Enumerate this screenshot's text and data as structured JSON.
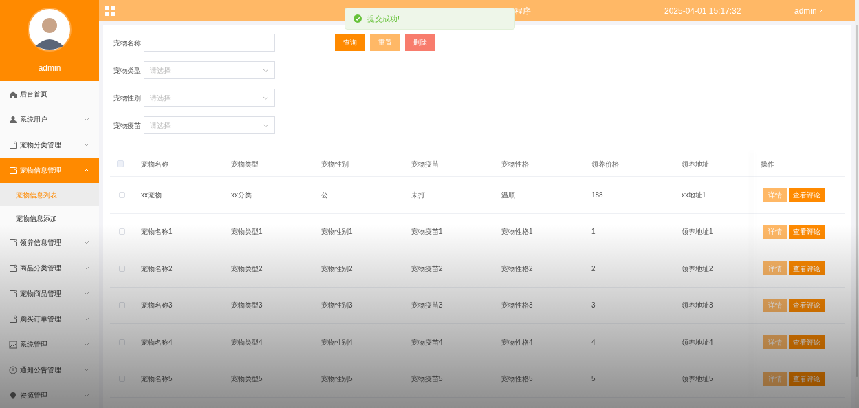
{
  "header": {
    "title": "程序",
    "datetime": "2025-04-01 15:17:32",
    "user": "admin"
  },
  "toast": {
    "message": "提交成功!"
  },
  "sidebar": {
    "username": "admin",
    "items": [
      {
        "label": "后台首页",
        "kind": "home",
        "selected": false
      },
      {
        "label": "系统用户",
        "kind": "user",
        "expanded": false,
        "selected": false
      },
      {
        "label": "宠物分类管理",
        "kind": "doc",
        "expanded": false,
        "selected": false
      },
      {
        "label": "宠物信息管理",
        "kind": "doc",
        "expanded": true,
        "selected": true,
        "children": [
          {
            "label": "宠物信息列表",
            "selected": true
          },
          {
            "label": "宠物信息添加",
            "selected": false
          }
        ]
      },
      {
        "label": "领养信息管理",
        "kind": "doc",
        "expanded": false,
        "selected": false
      },
      {
        "label": "商品分类管理",
        "kind": "doc",
        "expanded": false,
        "selected": false
      },
      {
        "label": "宠物商品管理",
        "kind": "doc",
        "expanded": false,
        "selected": false
      },
      {
        "label": "购买订单管理",
        "kind": "doc",
        "expanded": false,
        "selected": false
      },
      {
        "label": "系统管理",
        "kind": "image",
        "expanded": false,
        "selected": false
      },
      {
        "label": "通知公告管理",
        "kind": "info",
        "expanded": false,
        "selected": false
      },
      {
        "label": "资源管理",
        "kind": "pin",
        "expanded": false,
        "selected": false
      }
    ]
  },
  "filters": [
    {
      "label": "宠物名称",
      "kind": "text"
    },
    {
      "label": "宠物类型",
      "kind": "select",
      "placeholder": "请选择"
    },
    {
      "label": "宠物性别",
      "kind": "select",
      "placeholder": "请选择"
    },
    {
      "label": "宠物疫苗",
      "kind": "select",
      "placeholder": "请选择"
    }
  ],
  "actions": [
    {
      "label": "查询",
      "kind": "primary"
    },
    {
      "label": "重置",
      "kind": "light"
    },
    {
      "label": "删除",
      "kind": "danger"
    }
  ],
  "table": {
    "all_checked": false,
    "columns": [
      "宠物名称",
      "宠物类型",
      "宠物性别",
      "宠物疫苗",
      "宠物性格",
      "领养价格",
      "领养地址",
      "操作"
    ],
    "rows": [
      {
        "checked": false,
        "cells": [
          "xx宠物",
          "xx分类",
          "公",
          "未打",
          "温顺",
          "188",
          "xx地址1"
        ],
        "buttons": [
          "详情",
          "查看评论"
        ]
      },
      {
        "checked": false,
        "cells": [
          "宠物名称1",
          "宠物类型1",
          "宠物性别1",
          "宠物疫苗1",
          "宠物性格1",
          "1",
          "领养地址1"
        ],
        "buttons": [
          "详情",
          "查看评论"
        ]
      },
      {
        "checked": false,
        "cells": [
          "宠物名称2",
          "宠物类型2",
          "宠物性别2",
          "宠物疫苗2",
          "宠物性格2",
          "2",
          "领养地址2"
        ],
        "buttons": [
          "详情",
          "查看评论"
        ]
      },
      {
        "checked": false,
        "cells": [
          "宠物名称3",
          "宠物类型3",
          "宠物性别3",
          "宠物疫苗3",
          "宠物性格3",
          "3",
          "领养地址3"
        ],
        "buttons": [
          "详情",
          "查看评论"
        ]
      },
      {
        "checked": false,
        "cells": [
          "宠物名称4",
          "宠物类型4",
          "宠物性别4",
          "宠物疫苗4",
          "宠物性格4",
          "4",
          "领养地址4"
        ],
        "buttons": [
          "详情",
          "查看评论"
        ]
      },
      {
        "checked": false,
        "cells": [
          "宠物名称5",
          "宠物类型5",
          "宠物性别5",
          "宠物疫苗5",
          "宠物性格5",
          "5",
          "领养地址5"
        ],
        "buttons": [
          "详情",
          "查看评论"
        ]
      }
    ]
  }
}
